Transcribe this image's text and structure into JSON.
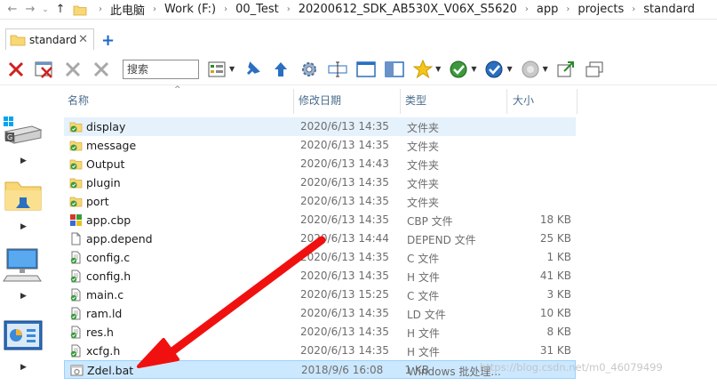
{
  "address": {
    "crumbs": [
      "此电脑",
      "Work (F:)",
      "00_Test",
      "20200612_SDK_AB530X_V06X_S5620",
      "app",
      "projects",
      "standard"
    ]
  },
  "tabs": [
    {
      "label": "standard"
    }
  ],
  "toolbar": {
    "search_placeholder": "搜索"
  },
  "columns": {
    "name": "名称",
    "date": "修改日期",
    "type": "类型",
    "size": "大小"
  },
  "files": [
    {
      "name": "display",
      "date": "2020/6/13 14:35",
      "type": "文件夹",
      "size": "",
      "icon": "folder-check-icon"
    },
    {
      "name": "message",
      "date": "2020/6/13 14:35",
      "type": "文件夹",
      "size": "",
      "icon": "folder-check-icon"
    },
    {
      "name": "Output",
      "date": "2020/6/13 14:43",
      "type": "文件夹",
      "size": "",
      "icon": "folder-check-icon"
    },
    {
      "name": "plugin",
      "date": "2020/6/13 14:35",
      "type": "文件夹",
      "size": "",
      "icon": "folder-check-icon"
    },
    {
      "name": "port",
      "date": "2020/6/13 14:35",
      "type": "文件夹",
      "size": "",
      "icon": "folder-check-icon"
    },
    {
      "name": "app.cbp",
      "date": "2020/6/13 14:35",
      "type": "CBP 文件",
      "size": "18 KB",
      "icon": "cbp-file-icon"
    },
    {
      "name": "app.depend",
      "date": "2020/6/13 14:44",
      "type": "DEPEND 文件",
      "size": "25 KB",
      "icon": "blank-file-icon"
    },
    {
      "name": "config.c",
      "date": "2020/6/13 14:35",
      "type": "C 文件",
      "size": "1 KB",
      "icon": "file-check-icon"
    },
    {
      "name": "config.h",
      "date": "2020/6/13 14:35",
      "type": "H 文件",
      "size": "41 KB",
      "icon": "file-check-icon"
    },
    {
      "name": "main.c",
      "date": "2020/6/13 15:25",
      "type": "C 文件",
      "size": "3 KB",
      "icon": "file-check-icon"
    },
    {
      "name": "ram.ld",
      "date": "2020/6/13 14:35",
      "type": "LD 文件",
      "size": "10 KB",
      "icon": "file-check-icon"
    },
    {
      "name": "res.h",
      "date": "2020/6/13 14:35",
      "type": "H 文件",
      "size": "8 KB",
      "icon": "file-check-icon"
    },
    {
      "name": "xcfg.h",
      "date": "2020/6/13 14:35",
      "type": "H 文件",
      "size": "31 KB",
      "icon": "file-check-icon"
    },
    {
      "name": "Zdel.bat",
      "date": "2018/9/6 16:08",
      "type": "Windows 批处理...",
      "size": "1 KB",
      "icon": "bat-file-icon"
    }
  ],
  "watermark": "https://blog.csdn.net/m0_46079499",
  "colors": {
    "accent": "#1e66c8",
    "selection": "#cce8ff",
    "hover": "#e5f1fb",
    "arrow": "#f01010"
  }
}
